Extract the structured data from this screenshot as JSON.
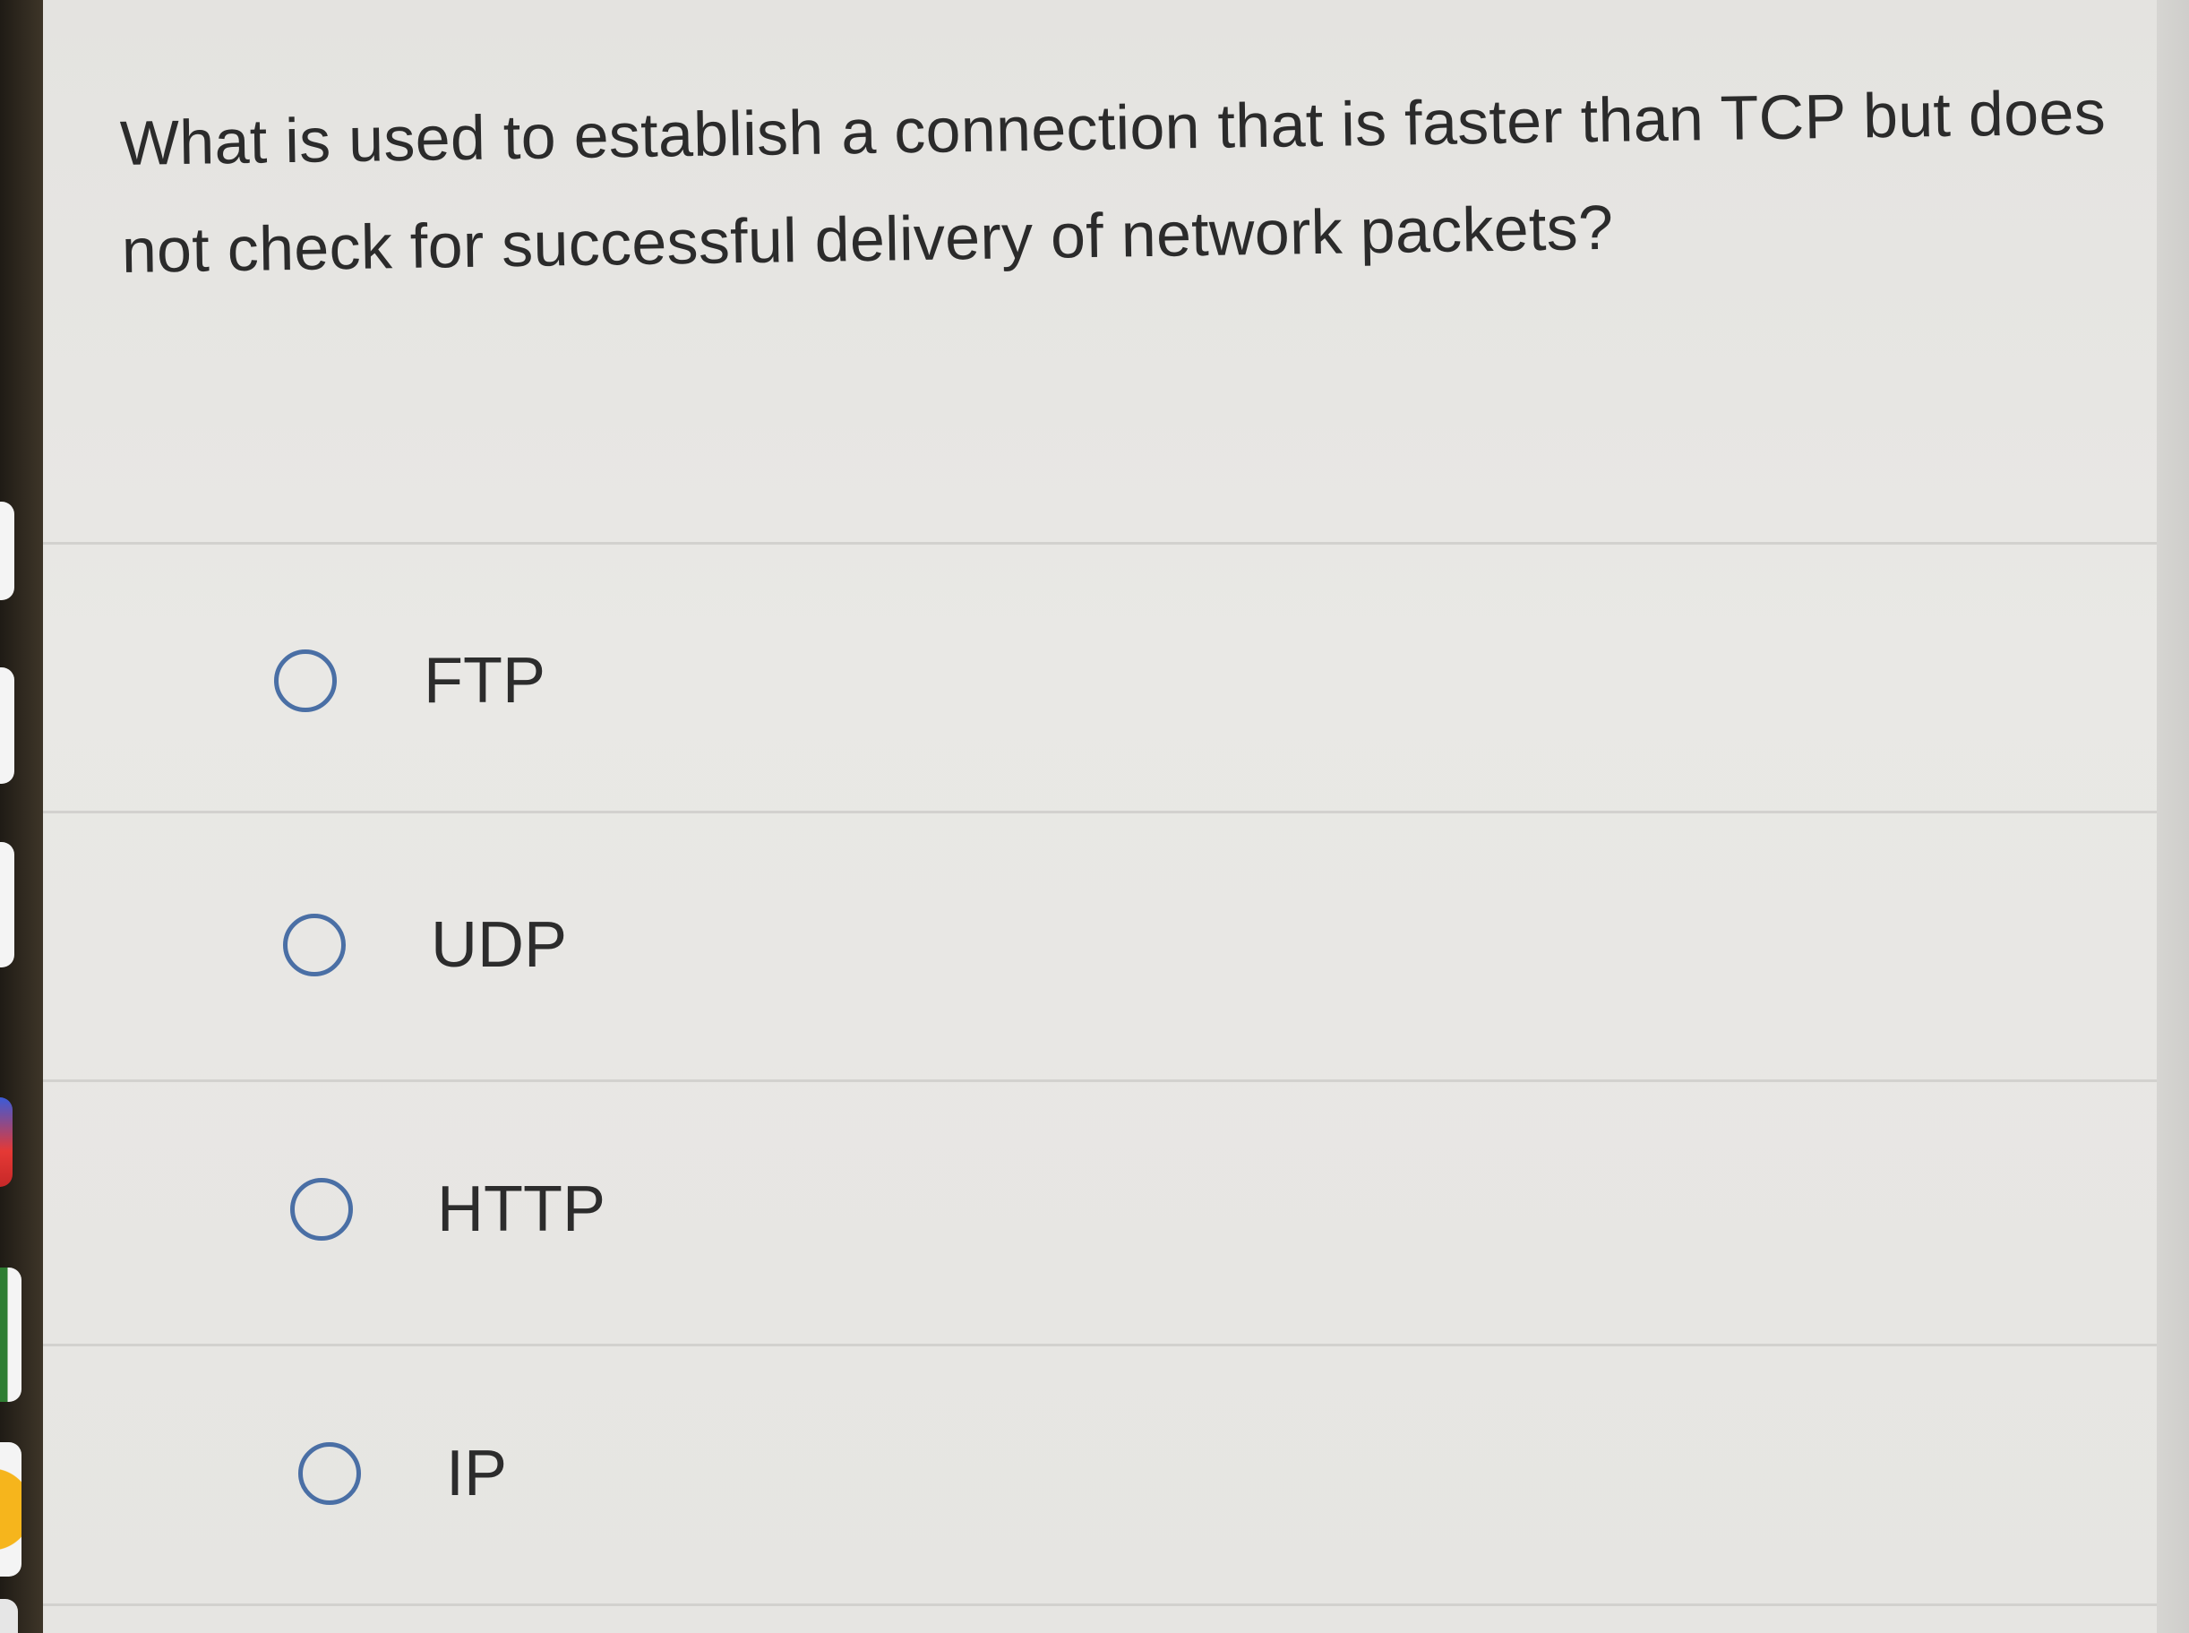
{
  "question": {
    "text": "What is used to establish a connection that is faster than TCP but does not check for successful delivery of network packets?"
  },
  "options": [
    {
      "label": "FTP",
      "selected": false
    },
    {
      "label": "UDP",
      "selected": false
    },
    {
      "label": "HTTP",
      "selected": false
    },
    {
      "label": "IP",
      "selected": false
    }
  ],
  "colors": {
    "radio_border": "#4a6fa5",
    "panel_background": "#e7e6e3",
    "text": "#2b2b2b"
  }
}
